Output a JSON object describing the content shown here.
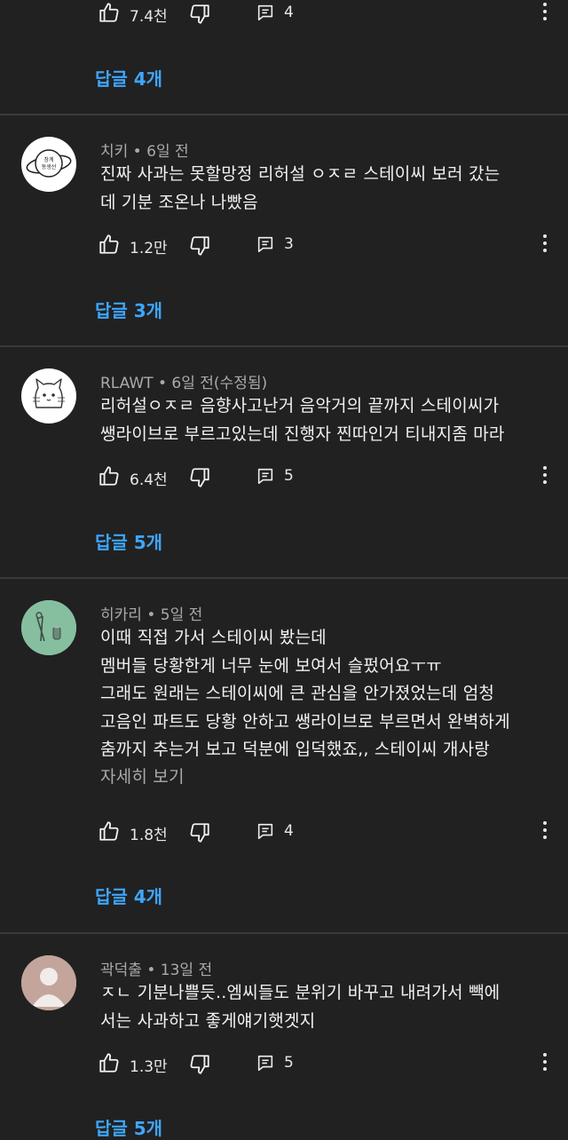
{
  "top_comment": {
    "likes": "7.4천",
    "reply_count": "4",
    "replies_label": "답글 4개"
  },
  "comments": [
    {
      "author": "치키",
      "time": "6일 전",
      "text": "진짜 사과는 못할망정 리허설 ㅇㅈㄹ  스테이씨 보러 갔는\n데 기분 조온나 나빴음",
      "likes": "1.2만",
      "reply_count": "3",
      "replies_label": "답글 3개"
    },
    {
      "author": "RLAWT",
      "time": "6일 전(수정됨)",
      "text": "리허설ㅇㅈㄹ 음향사고난거 음악거의 끝까지 스테이씨가\n쌩라이브로 부르고있는데 진행자 찐따인거 티내지좀 마라",
      "likes": "6.4천",
      "reply_count": "5",
      "replies_label": "답글 5개"
    },
    {
      "author": "히카리",
      "time": "5일 전",
      "text": "이때 직접 가서 스테이씨 봤는데\n멤버들 당황한게 너무 눈에 보여서 슬펐어요ㅜㅠ\n그래도 원래는 스테이씨에 큰 관심을 안가졌었는데 엄청\n고음인 파트도 당황 안하고 쌩라이브로 부르면서 완벽하게\n춤까지 추는거 보고 덕분에   입덕했죠,,  스테이씨 개사랑",
      "read_more": "자세히 보기",
      "likes": "1.8천",
      "reply_count": "4",
      "replies_label": "답글 4개"
    },
    {
      "author": "곽덕출",
      "time": "13일 전",
      "text": "ㅈㄴ 기분나쁠듯..엠씨들도 분위기 바꾸고 내려가서 빽에\n서는 사과하고 좋게얘기햇겟지",
      "likes": "1.3만",
      "reply_count": "5",
      "replies_label": "답글 5개"
    }
  ],
  "avatar_texts": {
    "chiki": [
      "창계",
      "동생선"
    ]
  },
  "ui": {
    "meta_separator": " • ",
    "replies_color": "#3ea6ff",
    "background": "#212121"
  }
}
